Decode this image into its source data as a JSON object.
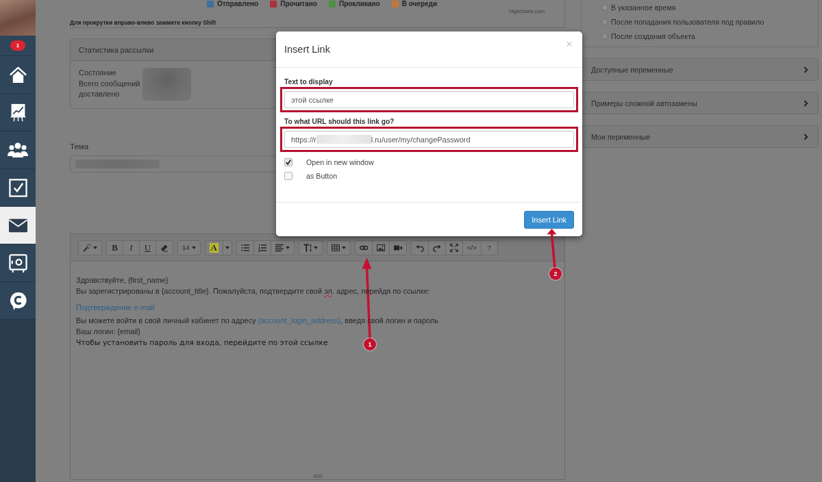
{
  "sidebar": {
    "badge": "1",
    "items": [
      {
        "selected": false
      },
      {
        "selected": false
      },
      {
        "selected": false
      },
      {
        "selected": false
      },
      {
        "selected": true
      },
      {
        "selected": false
      },
      {
        "selected": false
      }
    ]
  },
  "chart": {
    "legend": [
      {
        "label": "Отправлено",
        "color": "#3f6f9b"
      },
      {
        "label": "Прочитано",
        "color": "#a9343b"
      },
      {
        "label": "Прокликано",
        "color": "#4c8f45"
      },
      {
        "label": "В очереди",
        "color": "#c2763b"
      }
    ],
    "credit": "Highcharts.com",
    "hint": "Для прокрутки вправо-влево зажмите кнопку Shift"
  },
  "stats": {
    "title": "Статистика рассылки",
    "labels": [
      "Состояние",
      "Всего сообщений",
      "доставлено"
    ]
  },
  "subject": {
    "label": "Тема"
  },
  "editor": {
    "toolbar": [
      [
        {
          "kind": "icon",
          "dropdown": true
        }
      ],
      [
        {
          "kind": "bold",
          "label": "B",
          "dropdown": false
        },
        {
          "kind": "italic",
          "label": "I",
          "dropdown": false
        },
        {
          "kind": "underline",
          "label": "U",
          "dropdown": false
        },
        {
          "kind": "icon",
          "dropdown": false
        }
      ],
      [
        {
          "kind": "text",
          "label": "14",
          "dropdown": true
        }
      ],
      [
        {
          "kind": "highlight",
          "label": "A",
          "color": "#b8b82f",
          "dropdown": false
        },
        {
          "kind": "split",
          "dropdown": true
        }
      ],
      [
        {
          "kind": "icon",
          "dropdown": false
        },
        {
          "kind": "icon",
          "dropdown": false
        },
        {
          "kind": "icon",
          "dropdown": true
        }
      ],
      [
        {
          "kind": "icon",
          "dropdown": true
        }
      ],
      [
        {
          "kind": "icon",
          "dropdown": true
        }
      ],
      [
        {
          "kind": "icon",
          "dropdown": false
        },
        {
          "kind": "icon",
          "dropdown": false
        },
        {
          "kind": "icon",
          "dropdown": false
        }
      ],
      [
        {
          "kind": "icon",
          "dropdown": false
        },
        {
          "kind": "icon",
          "dropdown": false
        },
        {
          "kind": "icon",
          "dropdown": false
        },
        {
          "kind": "text",
          "label": "</>",
          "dropdown": false
        },
        {
          "kind": "text",
          "label": "?",
          "dropdown": false
        }
      ]
    ],
    "lines": [
      {
        "kind": "text",
        "parts": [
          {
            "kind": "text",
            "text": "Здравствуйте, {first_name}"
          }
        ]
      },
      {
        "kind": "text",
        "parts": [
          {
            "kind": "text",
            "text": "Вы зарегистрированы в {account_title}. Пожалуйста, подтвердите свой "
          },
          {
            "kind": "misspelled",
            "text": "эл"
          },
          {
            "kind": "text",
            "text": ". адрес, перейдя по ссылке:"
          }
        ]
      },
      {
        "kind": "block",
        "parts": [
          {
            "kind": "link",
            "text": "Подтверждение e-mail"
          }
        ]
      },
      {
        "kind": "text",
        "parts": [
          {
            "kind": "text",
            "text": "Вы можете войти в свой личный кабинет по адресу "
          },
          {
            "kind": "link",
            "text": "{account_login_address}"
          },
          {
            "kind": "text",
            "text": ", введя свой логин и пароль"
          }
        ]
      },
      {
        "kind": "text",
        "parts": [
          {
            "kind": "text",
            "text": "Ваш логин: {email}"
          }
        ]
      },
      {
        "kind": "plain",
        "parts": [
          {
            "kind": "text",
            "text": "Чтобы установить пароль для входа, перейдите по этой ссылке"
          }
        ]
      }
    ]
  },
  "send_options": [
    {
      "label": "В указанное время",
      "selected": false
    },
    {
      "label": "После попадания пользователя под правило",
      "selected": false
    },
    {
      "label": "После создания объекта",
      "selected": false
    }
  ],
  "panels": [
    {
      "title": "Доступные переменные",
      "expanded": false
    },
    {
      "title": "Примеры сложной автозамены",
      "expanded": false
    },
    {
      "title": "Мои переменные",
      "expanded": false
    }
  ],
  "modal": {
    "title": "Insert Link",
    "close": "×",
    "fields": [
      {
        "label": "Text to display",
        "value_parts": [
          "этой ссылке"
        ],
        "highlighted": true
      },
      {
        "label": "To what URL should this link go?",
        "value_parts": [
          "https://r",
          "l.ru/user/my/changePassword"
        ],
        "highlighted": true
      }
    ],
    "options": [
      {
        "label": "Open in new window",
        "checked": true
      },
      {
        "label": "as Button",
        "checked": false
      }
    ],
    "button": "Insert Link"
  },
  "annotations": [
    {
      "number": "1"
    },
    {
      "number": "2"
    }
  ]
}
